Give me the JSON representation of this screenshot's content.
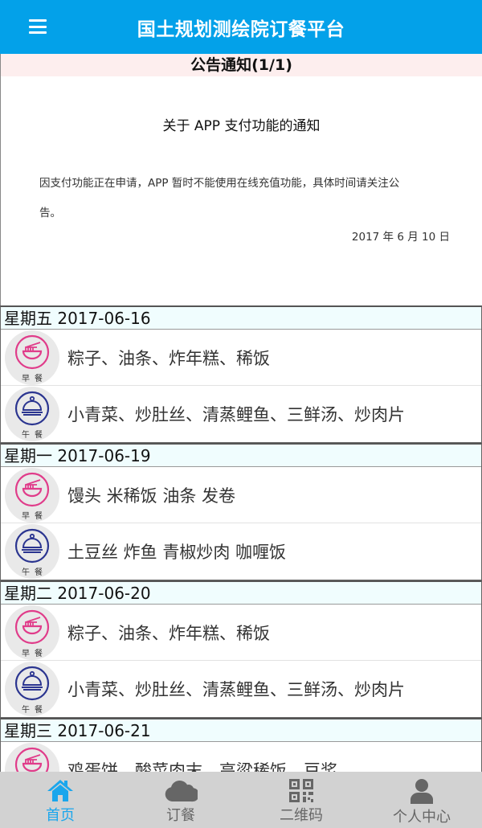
{
  "header": {
    "title": "国土规划测绘院订餐平台",
    "menu_icon": "hamburger-menu-icon"
  },
  "notice": {
    "heading": "公告通知(1/1)",
    "title": "关于 APP 支付功能的通知",
    "body": "因支付功能正在申请，APP 暂时不能使用在线充值功能，具体时间请关注公告。",
    "date": "2017 年 6 月 10 日"
  },
  "meal_tags": {
    "breakfast": "早餐",
    "lunch": "午餐"
  },
  "colors": {
    "primary": "#03a1e9",
    "breakfast_icon": "#e03c8a",
    "lunch_icon": "#2b3590",
    "tab_active": "#1aa6ec",
    "tab_inactive": "#666666"
  },
  "days": [
    {
      "label": "星期五 2017-06-16",
      "breakfast": "粽子、油条、炸年糕、稀饭",
      "lunch": "小青菜、炒肚丝、清蒸鲤鱼、三鲜汤、炒肉片"
    },
    {
      "label": "星期一 2017-06-19",
      "breakfast": "馒头 米稀饭 油条 发卷",
      "lunch": "土豆丝 炸鱼 青椒炒肉 咖喱饭"
    },
    {
      "label": "星期二 2017-06-20",
      "breakfast": "粽子、油条、炸年糕、稀饭",
      "lunch": "小青菜、炒肚丝、清蒸鲤鱼、三鲜汤、炒肉片"
    },
    {
      "label": "星期三 2017-06-21",
      "breakfast": "鸡蛋饼、酸菜肉末、高粱稀饭、豆浆"
    }
  ],
  "tabs": [
    {
      "label": "首页",
      "icon": "home-icon",
      "active": true
    },
    {
      "label": "订餐",
      "icon": "cloud-icon",
      "active": false
    },
    {
      "label": "二维码",
      "icon": "qr-code-icon",
      "active": false
    },
    {
      "label": "个人中心",
      "icon": "user-icon",
      "active": false
    }
  ]
}
